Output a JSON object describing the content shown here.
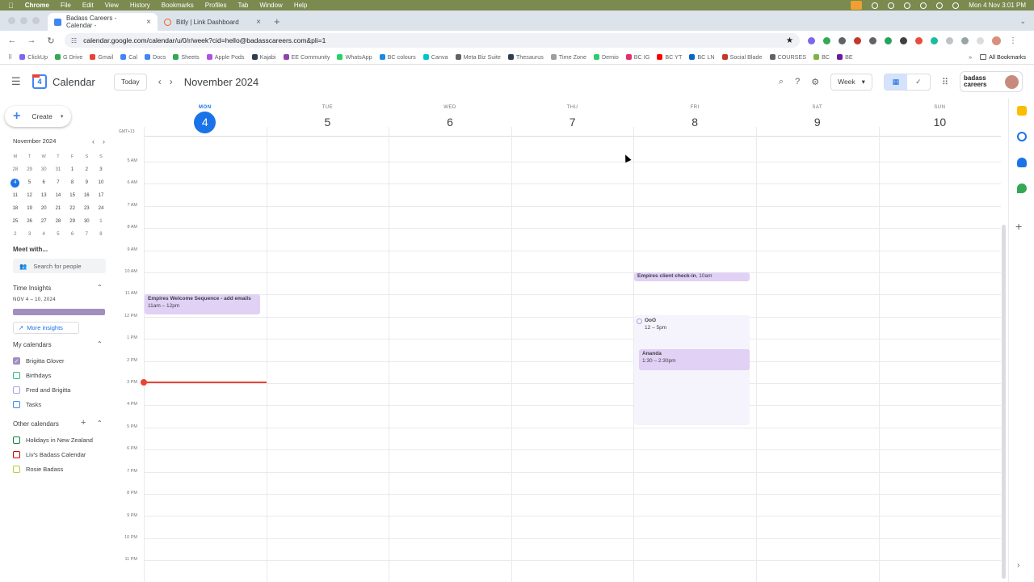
{
  "menubar": {
    "app": "Chrome",
    "items": [
      "File",
      "Edit",
      "View",
      "History",
      "Bookmarks",
      "Profiles",
      "Tab",
      "Window",
      "Help"
    ],
    "clock": "Mon 4 Nov  3:01 PM"
  },
  "tabs": [
    {
      "title": "Badass Careers - Calendar -",
      "icon": "calendar-favicon",
      "active": true
    },
    {
      "title": "Bitly | Link Dashboard",
      "icon": "bitly-favicon",
      "active": false
    }
  ],
  "address": {
    "url": "calendar.google.com/calendar/u/0/r/week?cid=hello@badasscareers.com&pli=1"
  },
  "bookmarks": [
    {
      "label": "ClickUp",
      "color": "#7b68ee"
    },
    {
      "label": "G Drive",
      "color": "#34a853"
    },
    {
      "label": "Gmail",
      "color": "#ea4335"
    },
    {
      "label": "Cal",
      "color": "#4285f4"
    },
    {
      "label": "Docs",
      "color": "#4285f4"
    },
    {
      "label": "Sheets",
      "color": "#34a853"
    },
    {
      "label": "Apple Pods",
      "color": "#b150e2"
    },
    {
      "label": "Kajabi",
      "color": "#2c3e50"
    },
    {
      "label": "EE Community",
      "color": "#8e44ad"
    },
    {
      "label": "WhatsApp",
      "color": "#25d366"
    },
    {
      "label": "BC colours",
      "color": "#1e88e5"
    },
    {
      "label": "Canva",
      "color": "#00c4cc"
    },
    {
      "label": "Meta Biz Suite",
      "color": "#5f6368"
    },
    {
      "label": "Thesaurus",
      "color": "#2c3e50"
    },
    {
      "label": "Time Zone",
      "color": "#9e9e9e"
    },
    {
      "label": "Demio",
      "color": "#2ecc71"
    },
    {
      "label": "BC IG",
      "color": "#e1306c"
    },
    {
      "label": "BC YT",
      "color": "#ff0000"
    },
    {
      "label": "BC LN",
      "color": "#0a66c2"
    },
    {
      "label": "Social Blade",
      "color": "#c0392b"
    },
    {
      "label": "COURSES",
      "color": "#5f6368"
    },
    {
      "label": "BC",
      "color": "#7cb342"
    },
    {
      "label": "BE",
      "color": "#6a1b9a"
    }
  ],
  "bookmarks_all": "All Bookmarks",
  "header": {
    "app_title": "Calendar",
    "logo_number": "4",
    "today_label": "Today",
    "month_title": "November 2024",
    "view_label": "Week",
    "brand_line1": "badass",
    "brand_line2": "careers"
  },
  "sidebar": {
    "create_label": "Create",
    "mini_month": "November 2024",
    "dow": [
      "M",
      "T",
      "W",
      "T",
      "F",
      "S",
      "S"
    ],
    "weeks": [
      [
        "28",
        "29",
        "30",
        "31",
        "1",
        "2",
        "3"
      ],
      [
        "4",
        "5",
        "6",
        "7",
        "8",
        "9",
        "10"
      ],
      [
        "11",
        "12",
        "13",
        "14",
        "15",
        "16",
        "17"
      ],
      [
        "18",
        "19",
        "20",
        "21",
        "22",
        "23",
        "24"
      ],
      [
        "25",
        "26",
        "27",
        "28",
        "29",
        "30",
        "1"
      ],
      [
        "2",
        "3",
        "4",
        "5",
        "6",
        "7",
        "8"
      ]
    ],
    "meet_title": "Meet with...",
    "search_people": "Search for people",
    "insights_title": "Time Insights",
    "insights_range": "NOV 4 – 10, 2024",
    "more_insights": "More insights",
    "my_calendars_title": "My calendars",
    "my_calendars": [
      {
        "name": "Brigitta Glover",
        "color": "#a28fc0",
        "checked": true
      },
      {
        "name": "Birthdays",
        "color": "#33b679",
        "checked": false
      },
      {
        "name": "Fred and Brigitta",
        "color": "#b39ddb",
        "checked": false
      },
      {
        "name": "Tasks",
        "color": "#4285f4",
        "checked": false
      }
    ],
    "other_calendars_title": "Other calendars",
    "other_calendars": [
      {
        "name": "Holidays in New Zealand",
        "color": "#0b8043",
        "checked": false
      },
      {
        "name": "Liv's Badass Calendar",
        "color": "#d50000",
        "checked": false
      },
      {
        "name": "Rosie Badass",
        "color": "#c0ca33",
        "checked": false
      }
    ]
  },
  "week": {
    "timezone": "GMT+13",
    "days": [
      {
        "dow": "MON",
        "num": "4",
        "today": true
      },
      {
        "dow": "TUE",
        "num": "5",
        "today": false
      },
      {
        "dow": "WED",
        "num": "6",
        "today": false
      },
      {
        "dow": "THU",
        "num": "7",
        "today": false
      },
      {
        "dow": "FRI",
        "num": "8",
        "today": false
      },
      {
        "dow": "SAT",
        "num": "9",
        "today": false
      },
      {
        "dow": "SUN",
        "num": "10",
        "today": false
      }
    ],
    "hours": [
      "5 AM",
      "6 AM",
      "7 AM",
      "8 AM",
      "9 AM",
      "10 AM",
      "11 AM",
      "12 PM",
      "1 PM",
      "2 PM",
      "3 PM",
      "4 PM",
      "5 PM",
      "6 PM",
      "7 PM",
      "8 PM",
      "9 PM",
      "10 PM",
      "11 PM"
    ]
  },
  "events": {
    "welcome": {
      "title": "Empires Welcome Sequence - add emails",
      "time": "11am – 12pm"
    },
    "checkin": {
      "title": "Empires client check-in",
      "time": ", 10am"
    },
    "ooo": {
      "title": "OoO",
      "time": "12 – 5pm"
    },
    "ananda": {
      "title": "Ananda",
      "time": "1:30 – 2:30pm"
    }
  },
  "colors": {
    "accent": "#1a73e8",
    "event": "#e1d1f5",
    "now_line": "#ea4335"
  }
}
